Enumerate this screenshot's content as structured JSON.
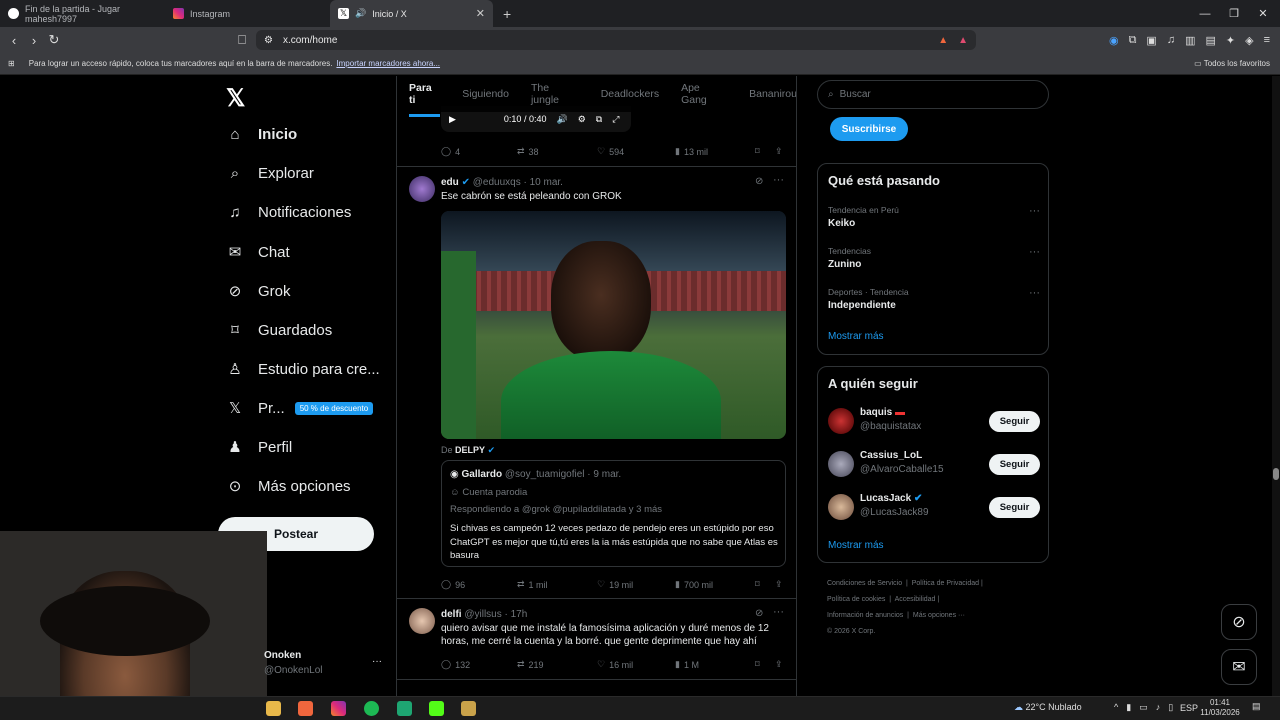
{
  "browser": {
    "tabs": [
      {
        "label": "Fin de la partida - Jugar mahesh7997"
      },
      {
        "label": "Instagram"
      },
      {
        "label": "Inicio / X"
      }
    ],
    "url": "x.com/home",
    "bookmarks_text": "Para lograr un acceso rápido, coloca tus marcadores aquí en la barra de marcadores.",
    "bookmarks_link": "Importar marcadores ahora...",
    "all_favorites": "Todos los favoritos"
  },
  "nav": {
    "items": [
      {
        "label": "Inicio",
        "icon": "home-icon"
      },
      {
        "label": "Explorar",
        "icon": "search-icon"
      },
      {
        "label": "Notificaciones",
        "icon": "bell-icon"
      },
      {
        "label": "Chat",
        "icon": "mail-icon"
      },
      {
        "label": "Grok",
        "icon": "grok-icon"
      },
      {
        "label": "Guardados",
        "icon": "bookmark-icon"
      },
      {
        "label": "Estudio para cre...",
        "icon": "studio-icon"
      },
      {
        "label": "Pr...",
        "icon": "x-premium-icon"
      },
      {
        "label": "Perfil",
        "icon": "person-icon"
      },
      {
        "label": "Más opciones",
        "icon": "more-icon"
      }
    ],
    "promo_badge": "50 % de descuento",
    "post_button": "Postear",
    "account_name": "Onoken",
    "account_handle": "@OnokenLol"
  },
  "feed": {
    "tabs": [
      "Para ti",
      "Siguiendo",
      "The jungle",
      "Deadlockers",
      "Ape Gang",
      "Bananirou"
    ],
    "video_time": "0:10 / 0:40",
    "post0_stats": {
      "replies": "4",
      "reposts": "38",
      "likes": "594",
      "views": "13 mil"
    },
    "post1": {
      "name": "edu",
      "handle": "@eduuxqs",
      "date": "· 10 mar.",
      "text": "Ese cabrón se está peleando con GROK",
      "from_prefix": "De",
      "from_name": "DELPY",
      "quote_name": "Gallardo",
      "quote_handle": "@soy_tuamigofiel",
      "quote_date": "· 9 mar.",
      "quote_label": "Cuenta parodia",
      "quote_reply": "Respondiendo a @grok @pupiladdilatada y 3 más",
      "quote_text": "Si chivas es campeón 12 veces pedazo de pendejo eres un estúpido por eso ChatGPT es mejor que tú,tú eres la ia más estúpida que no sabe que Atlas es basura",
      "stats": {
        "replies": "96",
        "reposts": "1 mil",
        "likes": "19 mil",
        "views": "700 mil"
      }
    },
    "post2": {
      "name": "delfi",
      "handle": "@yillsus",
      "date": "· 17h",
      "text": "quiero avisar que me instalé la famosísima aplicación y duré menos de 12 horas, me cerré la cuenta y la borré. que gente deprimente que hay ahí",
      "stats": {
        "replies": "132",
        "reposts": "219",
        "likes": "16 mil",
        "views": "1 M"
      }
    }
  },
  "right": {
    "search_placeholder": "Buscar",
    "subscribe": "Suscribirse",
    "trends_title": "Qué está pasando",
    "trends": [
      {
        "category": "Tendencia en Perú",
        "name": "Keiko"
      },
      {
        "category": "Tendencias",
        "name": "Zunino"
      },
      {
        "category": "Deportes · Tendencia",
        "name": "Independiente"
      }
    ],
    "show_more": "Mostrar más",
    "follow_title": "A quién seguir",
    "follow": [
      {
        "name": "baquis",
        "handle": "@baquistatax"
      },
      {
        "name": "Cassius_LoL",
        "handle": "@AlvaroCaballe15"
      },
      {
        "name": "LucasJack",
        "handle": "@LucasJack89"
      }
    ],
    "follow_button": "Seguir",
    "footer": [
      "Condiciones de Servicio",
      "Política de Privacidad",
      "Política de cookies",
      "Accesibilidad",
      "Información de anuncios",
      "Más opciones ···",
      "© 2026 X Corp."
    ]
  },
  "taskbar": {
    "weather": "22°C  Nublado",
    "lang": "ESP",
    "time": "01:41",
    "date": "11/03/2026"
  }
}
